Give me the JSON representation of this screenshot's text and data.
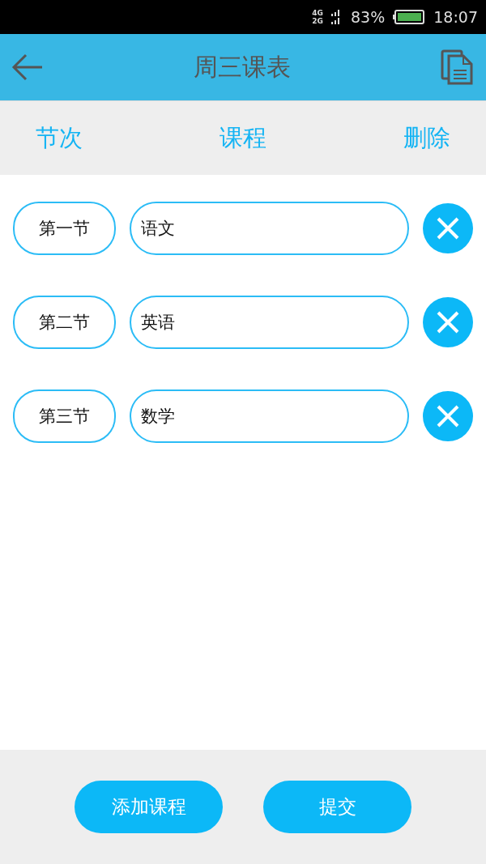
{
  "status_bar": {
    "network_top": "4G",
    "network_bottom": "2G",
    "battery": "83%",
    "time": "18:07"
  },
  "header": {
    "title": "周三课表"
  },
  "columns": [
    "节次",
    "课程",
    "删除"
  ],
  "rows": [
    {
      "period": "第一节",
      "course": "语文"
    },
    {
      "period": "第二节",
      "course": "英语"
    },
    {
      "period": "第三节",
      "course": "数学"
    }
  ],
  "buttons": [
    "添加课程",
    "提交"
  ]
}
